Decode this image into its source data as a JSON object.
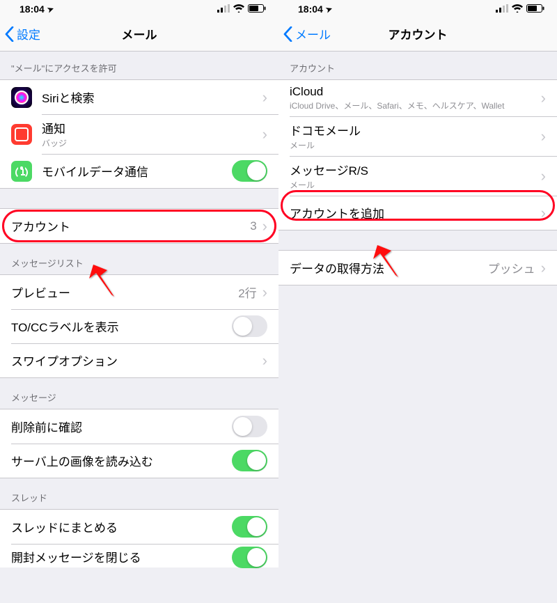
{
  "statusBar": {
    "time": "18:04",
    "locationGlyph": "➤"
  },
  "left": {
    "nav": {
      "back": "設定",
      "title": "メール"
    },
    "sectionAccess": "\"メール\"にアクセスを許可",
    "siri": {
      "label": "Siriと検索"
    },
    "notif": {
      "label": "通知",
      "sub": "バッジ"
    },
    "cellular": {
      "label": "モバイルデータ通信",
      "on": true
    },
    "accounts": {
      "label": "アカウント",
      "value": "3"
    },
    "sectionMsgList": "メッセージリスト",
    "preview": {
      "label": "プレビュー",
      "value": "2行"
    },
    "tocc": {
      "label": "TO/CCラベルを表示",
      "on": false
    },
    "swipe": {
      "label": "スワイプオプション"
    },
    "sectionMessage": "メッセージ",
    "confirmDelete": {
      "label": "削除前に確認",
      "on": false
    },
    "loadRemote": {
      "label": "サーバ上の画像を読み込む",
      "on": true
    },
    "sectionThread": "スレッド",
    "threadGroup": {
      "label": "スレッドにまとめる",
      "on": true
    },
    "closeRead": {
      "label": "開封メッセージを閉じる",
      "on": true
    }
  },
  "right": {
    "nav": {
      "back": "メール",
      "title": "アカウント"
    },
    "sectionAccounts": "アカウント",
    "accounts": [
      {
        "title": "iCloud",
        "sub": "iCloud Drive、メール、Safari、メモ、ヘルスケア、Wallet"
      },
      {
        "title": "ドコモメール",
        "sub": "メール"
      },
      {
        "title": "メッセージR/S",
        "sub": "メール"
      }
    ],
    "addAccount": "アカウントを追加",
    "fetch": {
      "label": "データの取得方法",
      "value": "プッシュ"
    }
  }
}
